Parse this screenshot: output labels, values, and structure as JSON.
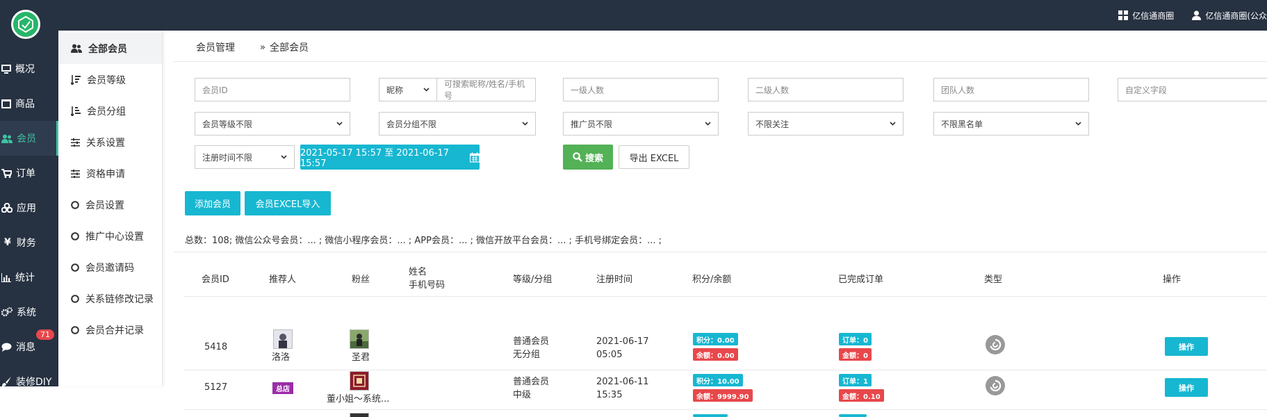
{
  "topbar": {
    "logo_text": "亿信通商圈",
    "store_label": "亿信通商圈",
    "user_label": "亿信通商圈(公众"
  },
  "leftnav": [
    {
      "label": "概况",
      "icon": "monitor-icon"
    },
    {
      "label": "商品",
      "icon": "store-icon"
    },
    {
      "label": "会员",
      "icon": "users-icon",
      "active": true
    },
    {
      "label": "订单",
      "icon": "cart-icon"
    },
    {
      "label": "应用",
      "icon": "cubes-icon"
    },
    {
      "label": "财务",
      "icon": "yen-icon"
    },
    {
      "label": "统计",
      "icon": "bar-chart-icon"
    },
    {
      "label": "系统",
      "icon": "gears-icon"
    },
    {
      "label": "消息",
      "icon": "chat-icon",
      "badge": "71"
    },
    {
      "label": "装修DIY",
      "icon": "brush-icon"
    }
  ],
  "subnav": [
    {
      "label": "全部会员",
      "icon": "users-icon",
      "active": true
    },
    {
      "label": "会员等级",
      "icon": "sort-desc-icon"
    },
    {
      "label": "会员分组",
      "icon": "sort-asc-icon"
    },
    {
      "label": "关系设置",
      "icon": "sliders-icon"
    },
    {
      "label": "资格申请",
      "icon": "sliders-icon"
    },
    {
      "label": "会员设置",
      "icon": "circle-icon"
    },
    {
      "label": "推广中心设置",
      "icon": "circle-icon"
    },
    {
      "label": "会员邀请码",
      "icon": "circle-icon"
    },
    {
      "label": "关系链修改记录",
      "icon": "circle-icon"
    },
    {
      "label": "会员合并记录",
      "icon": "circle-icon"
    }
  ],
  "breadcrumb": {
    "parent": "会员管理",
    "current": "全部会员"
  },
  "filters": {
    "member_id_placeholder": "会员ID",
    "nickname_select": "昵称",
    "search_placeholder": "可搜索昵称/姓名/手机号",
    "level1_placeholder": "一级人数",
    "level2_placeholder": "二级人数",
    "team_placeholder": "团队人数",
    "custom_placeholder": "自定义字段",
    "member_level": "会员等级不限",
    "member_group": "会员分组不限",
    "promoter": "推广员不限",
    "follow": "不限关注",
    "blacklist": "不限黑名单",
    "reg_time": "注册时间不限",
    "date_range": "2021-05-17 15:57 至 2021-06-17 15:57",
    "search_button": "搜索",
    "export_button": "导出 EXCEL"
  },
  "actions": {
    "add_member": "添加会员",
    "import_excel": "会员EXCEL导入"
  },
  "summary": "总数：108; 微信公众号会员：... ;  微信小程序会员：... ;  APP会员：... ;  微信开放平台会员：... ;  手机号绑定会员：... ;",
  "table": {
    "headers": {
      "id": "会员ID",
      "referrer": "推荐人",
      "fan": "粉丝",
      "name": "姓名",
      "phone": "手机号码",
      "level_group": "等级/分组",
      "reg_time": "注册时间",
      "points_balance": "积分/余额",
      "orders": "已完成订单",
      "type": "类型",
      "ops": "操作"
    },
    "rows": [
      {
        "id": "5418",
        "referrer": "洛洛",
        "referrer_badge": "",
        "fan": "圣君",
        "level": "普通会员",
        "group": "无分组",
        "date": "2021-06-17",
        "time": "05:05",
        "points": "积分：0.00",
        "balance": "余额：0.00",
        "orders": "订单：0",
        "amount": "金额：0",
        "op": "操作"
      },
      {
        "id": "5127",
        "referrer": "",
        "referrer_badge": "总店",
        "fan": "董小姐～系统...",
        "level": "普通会员",
        "group": "中级",
        "date": "2021-06-11",
        "time": "15:35",
        "points": "积分：10.00",
        "balance": "余额：9999.90",
        "orders": "订单：1",
        "amount": "金额：0.10",
        "op": "操作"
      }
    ]
  },
  "colors": {
    "sidebar": "#263141",
    "accent": "#3ec3a1",
    "primary": "#17b7d1",
    "success": "#53b156",
    "danger": "#e8474b"
  }
}
